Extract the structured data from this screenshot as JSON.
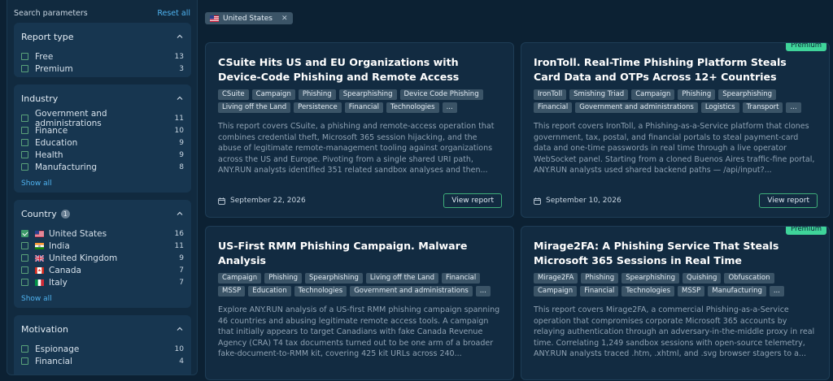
{
  "sidebar": {
    "title": "Search parameters",
    "reset": "Reset all",
    "report_type": {
      "title": "Report type",
      "options": [
        {
          "label": "Free",
          "count": "13"
        },
        {
          "label": "Premium",
          "count": "3"
        }
      ]
    },
    "industry": {
      "title": "Industry",
      "options": [
        {
          "label": "Government and administrations",
          "count": "11"
        },
        {
          "label": "Finance",
          "count": "10"
        },
        {
          "label": "Education",
          "count": "9"
        },
        {
          "label": "Health",
          "count": "9"
        },
        {
          "label": "Manufacturing",
          "count": "8"
        }
      ],
      "show_all": "Show all"
    },
    "country": {
      "title": "Country",
      "selected_count": "1",
      "options": [
        {
          "label": "United States",
          "count": "16",
          "checked": true
        },
        {
          "label": "India",
          "count": "11"
        },
        {
          "label": "United Kingdom",
          "count": "9"
        },
        {
          "label": "Canada",
          "count": "7"
        },
        {
          "label": "Italy",
          "count": "7"
        }
      ],
      "show_all": "Show all"
    },
    "motivation": {
      "title": "Motivation",
      "options": [
        {
          "label": "Espionage",
          "count": "10"
        },
        {
          "label": "Financial",
          "count": "4"
        }
      ]
    }
  },
  "active_filter": {
    "label": "United States"
  },
  "cards": [
    {
      "title": "CSuite Hits US and EU Organizations with Device-Code Phishing and Remote Access",
      "tags": [
        "CSuite",
        "Campaign",
        "Phishing",
        "Spearphishing",
        "Device Code Phishing",
        "Living off the Land",
        "Persistence",
        "Financial",
        "Technologies",
        "..."
      ],
      "description": "This report covers CSuite, a phishing and remote-access operation that combines credential theft, Microsoft 365 session hijacking, and the abuse of legitimate remote-management tooling against organizations across the US and Europe. Pivoting from a single shared URI path, ANY.RUN analysts identified 351 related sandbox analyses and then...",
      "date": "September 22, 2026",
      "button": "View report"
    },
    {
      "premium": "Premium",
      "title": "IronToll. Real-Time Phishing Platform Steals Card Data and OTPs Across 12+ Countries",
      "tags": [
        "IronToll",
        "Smishing Triad",
        "Campaign",
        "Phishing",
        "Spearphishing",
        "Financial",
        "Government and administrations",
        "Logistics",
        "Transport",
        "..."
      ],
      "description": "This report covers IronToll, a Phishing-as-a-Service platform that clones government, tax, postal, and financial portals to steal payment-card data and one-time passwords in real time through a live operator WebSocket panel. Starting from a cloned Buenos Aires traffic-fine portal, ANY.RUN analysts used shared backend paths — /api/input?...",
      "date": "September 10, 2026",
      "button": "View report"
    },
    {
      "title": "US-First RMM Phishing Campaign. Malware Analysis",
      "tags": [
        "Campaign",
        "Phishing",
        "Spearphishing",
        "Living off the Land",
        "Financial",
        "MSSP",
        "Education",
        "Technologies",
        "Government and administrations",
        "..."
      ],
      "description": "Explore ANY.RUN analysis of a US-first RMM phishing campaign spanning 46 countries and abusing legitimate remote access tools. A campaign that initially appears to target Canadians with fake Canada Revenue Agency (CRA) T4 tax documents turned out to be one arm of a broader fake-document-to-RMM kit, covering 425 kit URLs across 240..."
    },
    {
      "premium": "Premium",
      "title": "Mirage2FA: A Phishing Service That Steals Microsoft 365 Sessions in Real Time",
      "tags": [
        "Mirage2FA",
        "Phishing",
        "Spearphishing",
        "Quishing",
        "Obfuscation",
        "Campaign",
        "Financial",
        "Technologies",
        "MSSP",
        "Manufacturing",
        "..."
      ],
      "description": "This report covers Mirage2FA, a commercial Phishing-as-a-Service operation that compromises corporate Microsoft 365 accounts by relaying authentication through an adversary-in-the-middle proxy in real time. Correlating 1,249 sandbox sessions with open-source telemetry, ANY.RUN analysts traced .htm, .xhtml, and .svg browser stagers to a..."
    }
  ]
}
